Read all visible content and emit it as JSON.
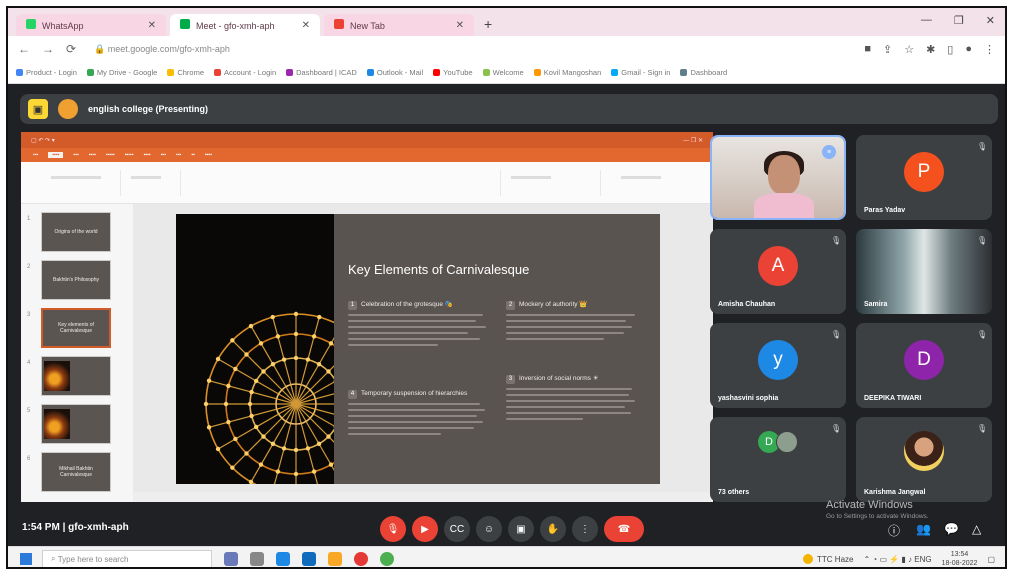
{
  "browser": {
    "tabs": [
      {
        "title": "WhatsApp",
        "color": "#25d366"
      },
      {
        "title": "Meet - gfo-xmh-aph",
        "color": "#00ac47"
      },
      {
        "title": "New Tab",
        "color": "#ea4335"
      }
    ],
    "url": "meet.google.com/gfo-xmh-aph",
    "bookmarks": [
      "Product - Login",
      "My Drive - Google",
      "Chrome",
      "Account - Login",
      "Dashboard | ICAD",
      "Outlook - Mail",
      "YouTube",
      "Welcome",
      "Kovil Mangoshan",
      "Gmail - Sign in",
      "Dashboard"
    ]
  },
  "presenting": {
    "title": "english college (Presenting)"
  },
  "slide": {
    "title": "Key Elements of Carnivalesque",
    "points": [
      {
        "num": "1",
        "heading": "Celebration of the grotesque"
      },
      {
        "num": "2",
        "heading": "Mockery of authority"
      },
      {
        "num": "3",
        "heading": "Inversion of social norms"
      },
      {
        "num": "4",
        "heading": "Temporary suspension of hierarchies"
      }
    ],
    "thumbnails": [
      "Origins of the world",
      "Bakhtin's Philosophy",
      "Key elements of Carnivalesque",
      "",
      "",
      "Mikhail Bakhtin Carnivalesque"
    ]
  },
  "participants": [
    {
      "name": "",
      "type": "camera",
      "speaking": true
    },
    {
      "name": "Paras Yadav",
      "initial": "P",
      "color": "#f4511e"
    },
    {
      "name": "Amisha Chauhan",
      "initial": "A",
      "color": "#ea4335"
    },
    {
      "name": "Samira",
      "type": "camera2"
    },
    {
      "name": "yashasvini sophia",
      "initial": "y",
      "color": "#1e88e5"
    },
    {
      "name": "DEEPIKA TIWARI",
      "initial": "D",
      "color": "#8e24aa"
    },
    {
      "name": "73 others",
      "initial": "D",
      "type": "others"
    },
    {
      "name": "Karishma Jangwal",
      "type": "photo"
    }
  ],
  "controls": {
    "meeting_info": "1:54 PM  |  gfo-xmh-aph"
  },
  "watermark": {
    "title": "Activate Windows",
    "subtitle": "Go to Settings to activate Windows."
  },
  "taskbar": {
    "search_placeholder": "Type here to search",
    "weather": "TTC  Haze",
    "time": "13:54",
    "date": "18-08-2022"
  }
}
